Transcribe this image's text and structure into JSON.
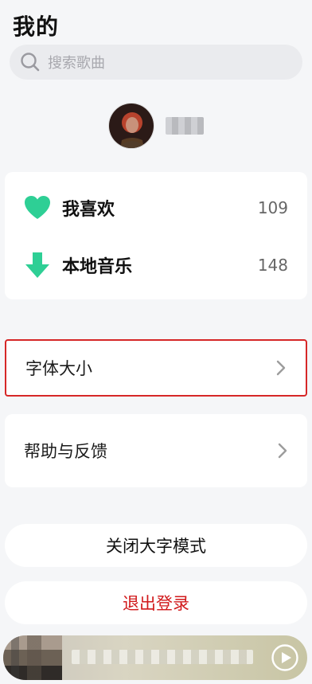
{
  "header": {
    "title": "我的"
  },
  "search": {
    "placeholder": "搜索歌曲",
    "icon": "search-icon"
  },
  "profile": {
    "avatar_icon": "avatar"
  },
  "library": {
    "items": [
      {
        "label": "我喜欢",
        "count": "109",
        "icon": "heart-icon",
        "color": "#2ecf95"
      },
      {
        "label": "本地音乐",
        "count": "148",
        "icon": "download-arrow-icon",
        "color": "#2ecf95"
      }
    ]
  },
  "settings": {
    "font_size_label": "字体大小",
    "help_label": "帮助与反馈"
  },
  "actions": {
    "close_large_font_label": "关闭大字模式",
    "logout_label": "退出登录"
  },
  "colors": {
    "accent": "#2ecf95",
    "danger": "#d1191b",
    "highlight_border": "#d62727"
  },
  "player": {
    "play_icon": "play-icon"
  }
}
